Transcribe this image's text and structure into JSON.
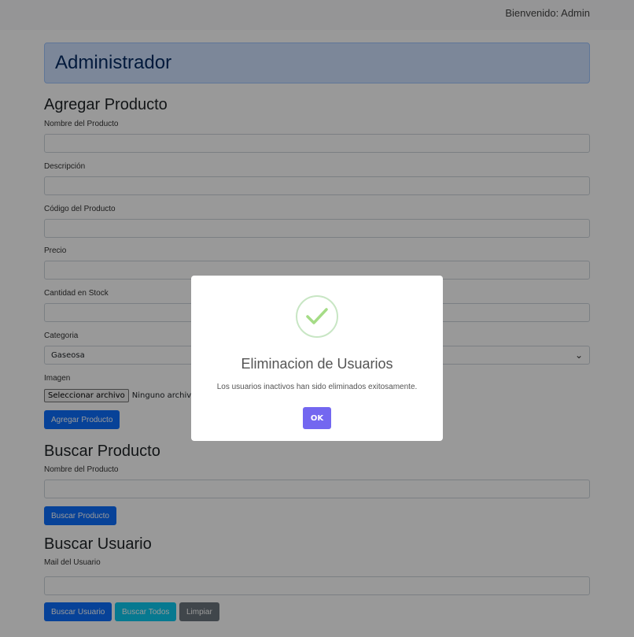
{
  "header": {
    "welcome": "Bienvenido: Admin"
  },
  "banner": {
    "title": "Administrador"
  },
  "add_product": {
    "title": "Agregar Producto",
    "fields": {
      "name_label": "Nombre del Producto",
      "description_label": "Descripción",
      "code_label": "Código del Producto",
      "price_label": "Precio",
      "stock_label": "Cantidad en Stock",
      "category_label": "Categoria",
      "category_value": "Gaseosa",
      "image_label": "Imagen",
      "file_button": "Seleccionar archivo",
      "file_status": "Ninguno archivo sele"
    },
    "submit_label": "Agregar Producto"
  },
  "search_product": {
    "title": "Buscar Producto",
    "name_label": "Nombre del Producto",
    "submit_label": "Buscar Producto"
  },
  "search_user": {
    "title": "Buscar Usuario",
    "mail_label": "Mail del Usuario",
    "search_label": "Buscar Usuario",
    "search_all_label": "Buscar Todos",
    "clear_label": "Limpiar"
  },
  "modal": {
    "icon": "success-check-icon",
    "title": "Eliminacion de Usuarios",
    "message": "Los usuarios inactivos han sido eliminados exitosamente.",
    "ok_label": "OK"
  },
  "colors": {
    "primary": "#0d6efd",
    "info": "#0dcaf0",
    "secondary": "#6c757d",
    "modal_ok": "#7367f0",
    "success_check": "#a5dc86"
  }
}
